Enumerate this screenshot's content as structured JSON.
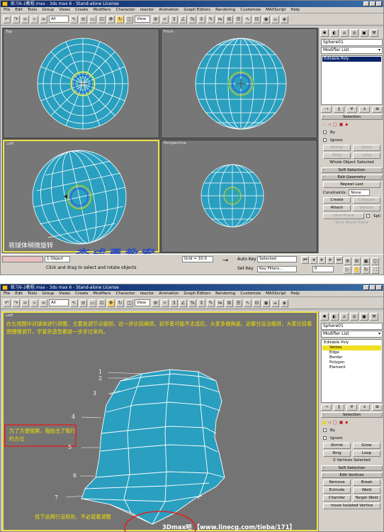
{
  "shot1": {
    "title": "练习6-2教程.max - 3ds max 6 - Stand-alone License",
    "menu": [
      "File",
      "Edit",
      "Tools",
      "Group",
      "Views",
      "Create",
      "Modifiers",
      "Character",
      "reactor",
      "Animation",
      "Graph Editors",
      "Rendering",
      "Customize",
      "MAXScript",
      "Help"
    ],
    "toolbar_select": "All",
    "toolbar_view": "View",
    "viewports": [
      {
        "label": "Top"
      },
      {
        "label": "Front"
      },
      {
        "label": "Left"
      },
      {
        "label": "Perspective"
      }
    ],
    "left_caption": "将球体稍微旋转",
    "watermark": "李成勇教案",
    "command_panel": {
      "object_name": "Sphere01",
      "modifier_list": "Modifier List",
      "stack_item": "Editable Poly",
      "rollout_selection": "Selection",
      "by_label": "By",
      "ignore_label": "Ignore",
      "shrink": "Shrink",
      "grow": "Grow",
      "ring": "Ring",
      "loop": "Loop",
      "selection_status": "Whole Object Selected",
      "rollout_soft": "Soft Selection",
      "rollout_edit_geometry": "Edit Geometry",
      "repeat_last": "Repeat Last",
      "constraints": "Constraints:",
      "constraints_value": "None",
      "create": "Create",
      "collapse": "Collapse",
      "attach": "Attach",
      "detach": "Detach",
      "slice_plane": "Slice Plane",
      "split": "Spli",
      "last_row": "Slice   Reset Plane"
    },
    "status": {
      "object_count": "1 Object",
      "prompt": "Click and drag to select and rotate objects",
      "grid": "Grid = 10.0",
      "auto_key": "Auto Key",
      "selected": "Selected",
      "set_key": "Set Key",
      "key_filters": "Key Filters...",
      "frame": "0"
    }
  },
  "shot2": {
    "title": "练习6-2教程.max - 3ds max 6 - Stand-alone License",
    "menu": [
      "File",
      "Edit",
      "Tools",
      "Group",
      "Views",
      "Create",
      "Modifiers",
      "Character",
      "reactor",
      "Animation",
      "Graph Editors",
      "Rendering",
      "Customize",
      "MAXScript",
      "Help"
    ],
    "toolbar_select": "All",
    "toolbar_view": "View",
    "viewport_label": "Left",
    "annotation_top": "在左视图中对球体进行调整，主要是调节点级别，这一步比较麻烦，初学者可能不太适应，大家多做两遍，这都分没法细讲，大家比较着图慢慢调节，学复杂造型都是一步步过来的。",
    "annotation_box": "为了方便观察，我给出了每行的方位",
    "annotation_bottom": "低下这两行没用处，不必就着调整",
    "row_numbers": [
      "1",
      "2",
      "3",
      "4",
      "5",
      "6",
      "7"
    ],
    "footer": "3Dmax吧 【www.linecg.com/tieba/171】",
    "command_panel": {
      "object_name": "Sphere01",
      "modifier_list": "Modifier List",
      "stack": [
        "Editable Poly",
        "Vertex",
        "Edge",
        "Border",
        "Polygon",
        "Element"
      ],
      "rollout_selection": "Selection",
      "by_label": "By",
      "ignore_label": "Ignore",
      "shrink": "Shrink",
      "grow": "Grow",
      "ring": "Ring",
      "loop": "Loop",
      "selection_status": "0 Vertices Selected",
      "rollout_soft": "Soft Selection",
      "rollout_edit_vertices": "Edit Vertices",
      "remove": "Remove",
      "break": "Break",
      "extrude": "Extrude",
      "weld": "Weld",
      "chamfer": "Chamfer",
      "target_weld": "Target Weld",
      "remove_isolated": "move Isolated Vertice"
    }
  },
  "colors": {
    "sphere": "#2a9fbf",
    "wire": "#ffffff",
    "viewport_bg": "#777777",
    "active_border": "#f0e050",
    "watermark": "#3050c0",
    "annotation": "#f0e000",
    "callout": "#e02020"
  }
}
